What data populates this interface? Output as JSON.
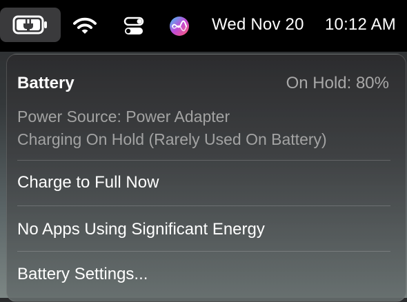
{
  "menubar": {
    "icons": [
      "battery-charging-icon",
      "wifi-icon",
      "control-center-icon",
      "siri-icon"
    ],
    "date": "Wed Nov 20",
    "time": "10:12 AM"
  },
  "battery_menu": {
    "title": "Battery",
    "status": "On Hold: 80%",
    "power_source": "Power Source: Power Adapter",
    "charging_note": "Charging On Hold (Rarely Used On Battery)",
    "items": [
      "Charge to Full Now",
      "No Apps Using Significant Energy",
      "Battery Settings..."
    ]
  },
  "colors": {
    "menubar_bg": "#000000",
    "active_icon_bg": "#3a3a3c",
    "primary_text": "#ffffff",
    "secondary_text": "#a3a3a3",
    "battery_fill": "#ffffff"
  }
}
